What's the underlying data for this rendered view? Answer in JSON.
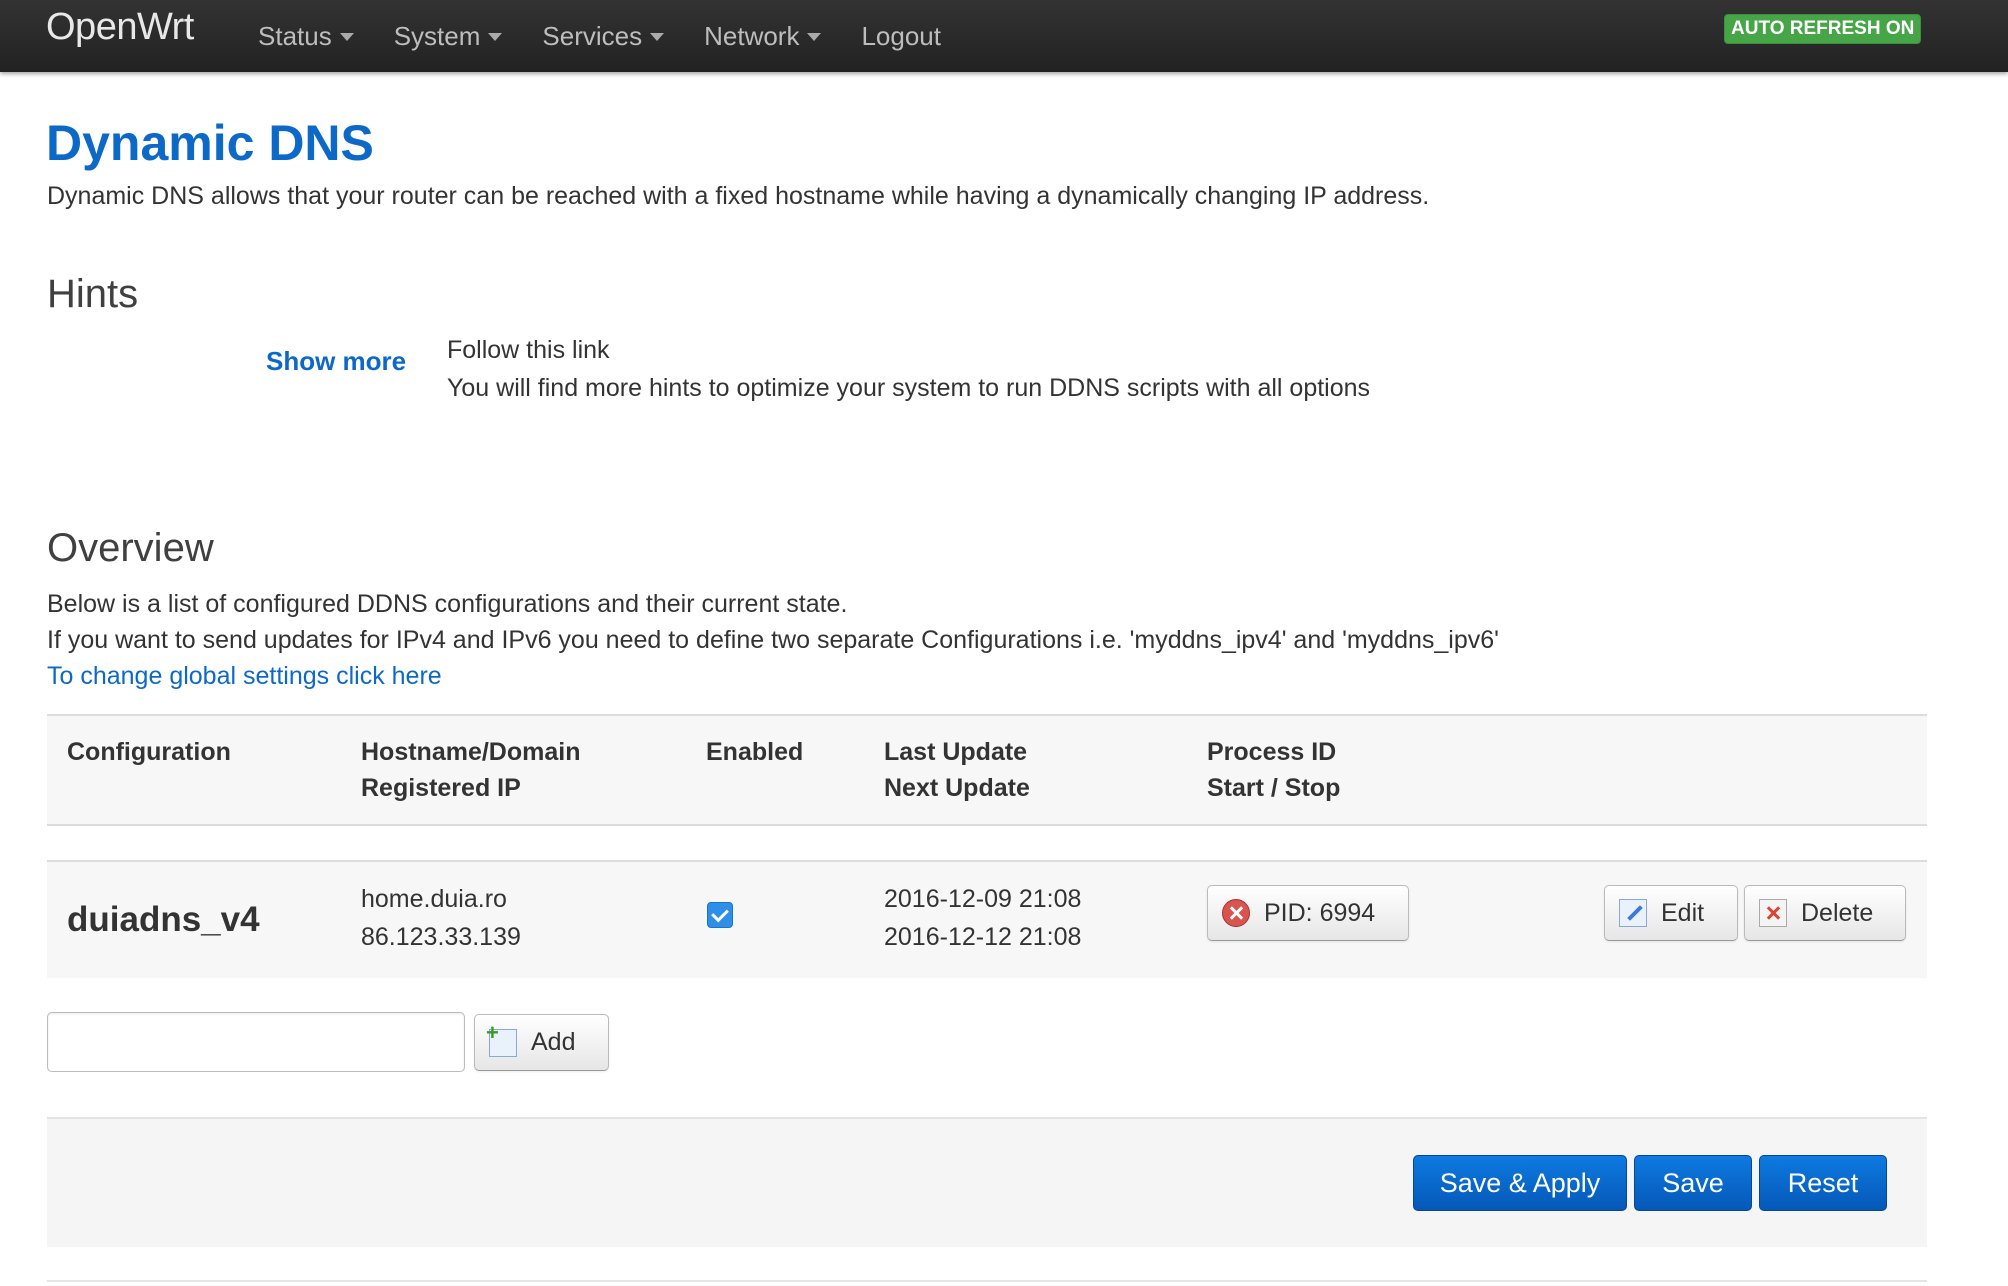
{
  "topbar": {
    "brand": "OpenWrt",
    "nav": [
      {
        "label": "Status",
        "dropdown": true
      },
      {
        "label": "System",
        "dropdown": true
      },
      {
        "label": "Services",
        "dropdown": true
      },
      {
        "label": "Network",
        "dropdown": true
      },
      {
        "label": "Logout",
        "dropdown": false
      }
    ],
    "auto_refresh": "AUTO REFRESH ON"
  },
  "page": {
    "title": "Dynamic DNS",
    "description": "Dynamic DNS allows that your router can be reached with a fixed hostname while having a dynamically changing IP address."
  },
  "hints": {
    "heading": "Hints",
    "show_more": "Show more",
    "line1": "Follow this link",
    "line2": "You will find more hints to optimize your system to run DDNS scripts with all options"
  },
  "overview": {
    "heading": "Overview",
    "line1": "Below is a list of configured DDNS configurations and their current state.",
    "line2": "If you want to send updates for IPv4 and IPv6 you need to define two separate Configurations i.e. 'myddns_ipv4' and 'myddns_ipv6'",
    "global_link": "To change global settings click here",
    "columns": [
      {
        "line1": "Configuration",
        "line2": ""
      },
      {
        "line1": "Hostname/Domain",
        "line2": "Registered IP"
      },
      {
        "line1": "Enabled",
        "line2": ""
      },
      {
        "line1": "Last Update",
        "line2": "Next Update"
      },
      {
        "line1": "Process ID",
        "line2": "Start / Stop"
      }
    ],
    "rows": [
      {
        "name": "duiadns_v4",
        "hostname": "home.duia.ro",
        "registered_ip": "86.123.33.139",
        "enabled": true,
        "last_update": "2016-12-09 21:08",
        "next_update": "2016-12-12 21:08",
        "pid_label": "PID: 6994",
        "edit_label": "Edit",
        "delete_label": "Delete"
      }
    ],
    "add_input_value": "",
    "add_label": "Add"
  },
  "footer": {
    "save_apply": "Save & Apply",
    "save": "Save",
    "reset": "Reset"
  },
  "colors": {
    "link_blue": "#0d69c8",
    "auto_refresh_green": "#46a546",
    "primary_button": "#0a6ad4",
    "checkbox_blue": "#2f8ee8"
  }
}
